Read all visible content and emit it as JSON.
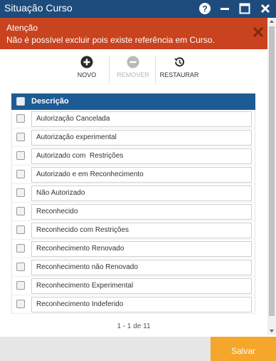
{
  "window": {
    "title": "Situação Curso"
  },
  "alert": {
    "title": "Atenção",
    "message": "Não é possível excluir pois existe referência em Curso.",
    "color": "#c9431e"
  },
  "toolbar": {
    "new_label": "NOVO",
    "remove_label": "REMOVER",
    "restore_label": "RESTAURAR"
  },
  "grid": {
    "header": "Descrição",
    "header_color": "#1d5b94",
    "rows": [
      "Autorização Cancelada",
      "Autorização experimental",
      "Autorizado com  Restrições",
      "Autorizado e em Reconhecimento",
      "Não Autorizado",
      "Reconhecido",
      "Reconhecido com Restrições",
      "Reconhecimento Renovado",
      "Reconhecimento não Renovado",
      "Reconhecimento Experimental",
      "Reconhecimento Indeferido"
    ]
  },
  "pager": {
    "text": "1 - 1 de 11"
  },
  "footer": {
    "save_label": "Salvar",
    "save_color": "#f4a72a"
  }
}
